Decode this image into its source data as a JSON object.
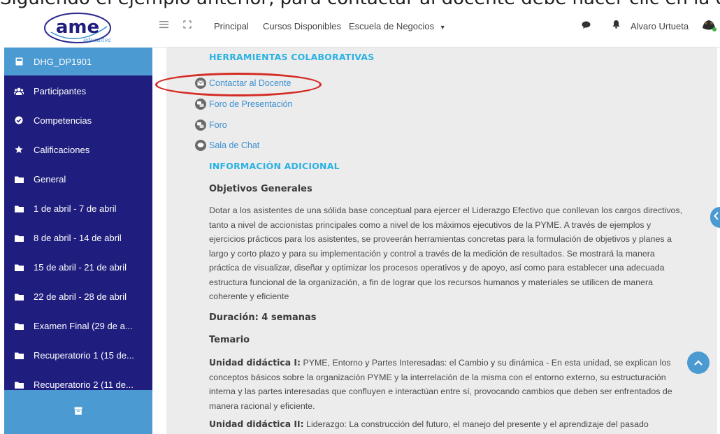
{
  "caption": "Siguiendo el ejemplo anterior, para contactar al docente debe hacer clic en la opción correspondiente",
  "logo": {
    "text": "ame",
    "tagline": "educativa"
  },
  "navbar": {
    "links": [
      "Principal",
      "Cursos Disponibles",
      "Escuela de Negocios"
    ],
    "user_name": "Alvaro Urtueta"
  },
  "sidebar": {
    "items": [
      {
        "label": "DHG_DP1901",
        "icon": "course-icon"
      },
      {
        "label": "Participantes",
        "icon": "users-icon"
      },
      {
        "label": "Competencias",
        "icon": "check-circle-icon"
      },
      {
        "label": "Calificaciones",
        "icon": "star-icon"
      },
      {
        "label": "General",
        "icon": "folder-icon"
      },
      {
        "label": "1 de abril - 7 de abril",
        "icon": "folder-icon"
      },
      {
        "label": "8 de abril - 14 de abril",
        "icon": "folder-icon"
      },
      {
        "label": "15 de abril - 21 de abril",
        "icon": "folder-icon"
      },
      {
        "label": "22 de abril - 28 de abril",
        "icon": "folder-icon"
      },
      {
        "label": "Examen Final (29 de a...",
        "icon": "folder-icon"
      },
      {
        "label": "Recuperatorio 1 (15 de...",
        "icon": "folder-icon"
      },
      {
        "label": "Recuperatorio 2 (11 de...",
        "icon": "folder-icon"
      }
    ]
  },
  "content": {
    "tools_title": "HERRAMIENTAS COLABORATIVAS",
    "activities": [
      {
        "label": "Contactar al Docente",
        "icon": "mail-icon"
      },
      {
        "label": "Foro de Presentación",
        "icon": "forum-icon"
      },
      {
        "label": "Foro",
        "icon": "forum-icon"
      },
      {
        "label": "Sala de Chat",
        "icon": "chat-icon"
      }
    ],
    "info_title": "INFORMACIÓN ADICIONAL",
    "objectives_title": "Objetivos Generales",
    "objectives_text": "Dotar a los asistentes de una sólida base conceptual para ejercer el Liderazgo Efectivo que conllevan los cargos directivos, tanto a nivel de accionistas principales como a nivel de los máximos ejecutivos de la PYME. A través de ejemplos y ejercicios prácticos para los asistentes, se proveerán herramientas concretas para la formulación de objetivos y planes a largo y corto plazo y para su implementación y control a través de la medición de resultados. Se mostrará la manera práctica de visualizar, diseñar y optimizar los procesos operativos y de apoyo, así como para establecer una adecuada estructura funcional de la organización, a fin de lograr que los recursos humanos y materiales se utilicen de manera coherente y eficiente",
    "duration": "Duración: 4 semanas",
    "syllabus_title": "Temario",
    "unit1_label": "Unidad didáctica I:",
    "unit1_text": " PYME, Entorno y Partes Interesadas: el Cambio y su dinámica - En esta unidad, se explican los conceptos básicos sobre la organización PYME y la interrelación de la misma con el entorno externo, su estructuración interna y las partes interesadas que confluyen e interactúan entre sí, provocando cambios que deben ser enfrentados de manera racional y eficiente.",
    "unit2_label": "Unidad didáctica II:",
    "unit2_text": " Liderazgo: La construcción del futuro, el manejo del presente y el aprendizaje del pasado"
  },
  "colors": {
    "sidebar_bg": "#1f1e7e",
    "accent": "#4b9ad2",
    "section_title": "#2bb2e2",
    "link": "#3b8fd0",
    "highlight_ellipse": "#d42b24"
  }
}
